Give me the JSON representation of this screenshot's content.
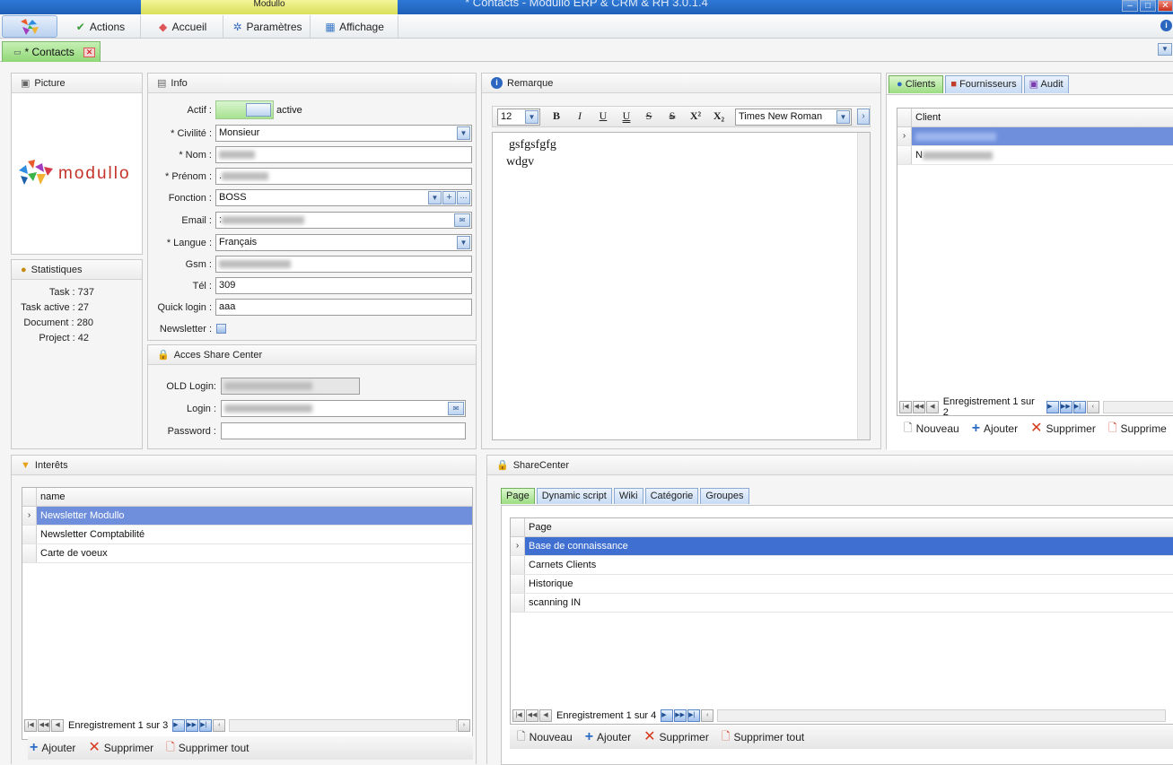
{
  "titlebar": {
    "center_label": "Modullo",
    "title": "* Contacts - Modullo ERP & CRM & RH 3.0.1.4"
  },
  "ribbon": {
    "tabs": [
      "Actions",
      "Accueil",
      "Paramètres",
      "Affichage"
    ]
  },
  "doc_tab": {
    "label": "* Contacts"
  },
  "picture": {
    "title": "Picture",
    "logo_text": "modullo"
  },
  "stats": {
    "title": "Statistiques",
    "items": [
      {
        "label": "Task : 737"
      },
      {
        "label": "Task active : 27"
      },
      {
        "label": "Document : 280"
      },
      {
        "label": "Project : 42"
      }
    ]
  },
  "info": {
    "title": "Info",
    "actif_label": "Actif :",
    "actif_value": "active",
    "civilite_label": "* Civilité :",
    "civilite_value": "Monsieur",
    "nom_label": "* Nom :",
    "prenom_label": "* Prénom :",
    "prenom_prefix": ".",
    "fonction_label": "Fonction :",
    "fonction_value": "BOSS",
    "email_label": "Email :",
    "email_prefix": ":",
    "langue_label": "* Langue :",
    "langue_value": "Français",
    "gsm_label": "Gsm :",
    "tel_label": "Tél :",
    "tel_value": "309",
    "quick_label": "Quick login :",
    "quick_value": "aaa",
    "newsletter_label": "Newsletter :"
  },
  "share": {
    "title": "Acces Share Center",
    "old_login_label": "OLD Login:",
    "login_label": "Login :",
    "password_label": "Password :"
  },
  "remarque": {
    "title": "Remarque",
    "font_size": "12",
    "font_name": "Times New Roman",
    "line1": "gsfgsfgfg",
    "line2": "wdgv"
  },
  "clients": {
    "tabs": [
      "Clients",
      "Fournisseurs",
      "Audit"
    ],
    "column": "Client",
    "row2_prefix": "N",
    "nav_text": "Enregistrement 1 sur 2",
    "actions": [
      "Nouveau",
      "Ajouter",
      "Supprimer",
      "Supprime"
    ]
  },
  "interets": {
    "title": "Interêts",
    "column": "name",
    "rows": [
      "Newsletter Modullo",
      "Newsletter Comptabilité",
      "Carte de voeux"
    ],
    "nav_text": "Enregistrement 1 sur 3",
    "actions": [
      "Ajouter",
      "Supprimer",
      "Supprimer tout"
    ]
  },
  "sharecenter": {
    "title": "ShareCenter",
    "tabs": [
      "Page",
      "Dynamic script",
      "Wiki",
      "Catégorie",
      "Groupes"
    ],
    "column": "Page",
    "rows": [
      "Base de connaissance",
      "Carnets Clients",
      "Historique",
      "scanning IN"
    ],
    "nav_text": "Enregistrement 1 sur 4",
    "actions": [
      "Nouveau",
      "Ajouter",
      "Supprimer",
      "Supprimer tout"
    ]
  },
  "colors": {
    "accent": "#3f6fd1",
    "selected_row": "#6f8fdc",
    "active_tab": "#9bdd82",
    "title_bar": "#1e5fb8"
  }
}
